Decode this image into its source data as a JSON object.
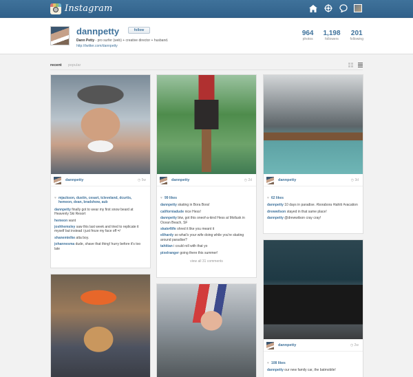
{
  "header": {
    "brand": "Instagram",
    "icons": [
      "home-icon",
      "explore-icon",
      "news-icon",
      "user-avatar"
    ]
  },
  "profile": {
    "username": "dannpetty",
    "follow_label": "follow",
    "bio_name": "Dann Petty",
    "bio_text": " - pro surfer (web) + creative director + husband.",
    "url": "http://twitter.com/dannpetty",
    "stats": [
      {
        "num": "964",
        "label": "photos"
      },
      {
        "num": "1,198",
        "label": "followers"
      },
      {
        "num": "201",
        "label": "following"
      }
    ]
  },
  "tabs": {
    "recent": "recent",
    "popular": "popular"
  },
  "posts": [
    {
      "user": "dannpetty",
      "time": "5w",
      "likes": "mjackson, dustin, cesart, tcleveland, dcurtis, hemeon, dean, bradshow, aub",
      "comments": [
        {
          "u": "dannpetty",
          "t": "finally got to wear my first snow beard at Heavenly Ski Resort"
        },
        {
          "u": "hemeon",
          "t": "want"
        },
        {
          "u": "joshhemsley",
          "t": "saw this last week and tried to replicate it myself but instead i just froze my face off =/"
        },
        {
          "u": "shanemielke",
          "t": "atta boy."
        },
        {
          "u": "johannesma",
          "t": "dude, shave that thing! hurry before it's too late"
        }
      ]
    },
    {
      "user": "dannpetty",
      "time": "2d",
      "likes": "99 likes",
      "comments": [
        {
          "u": "dannpetty",
          "t": "skating in Bora Bora!"
        },
        {
          "u": "californiadude",
          "t": "nice Hess!"
        },
        {
          "u": "dannpetty",
          "t": "btw, got this oneof-a-kind Hess at Mollusk in Ocean Beach, SF"
        },
        {
          "u": "skate4life",
          "t": "shred it like you meant it"
        },
        {
          "u": "elihardy",
          "t": "so what's your wife doing while you're skating around paradise?"
        },
        {
          "u": "tahitian",
          "t": "i could roll with that yo"
        },
        {
          "u": "pixelranger",
          "t": "going there this summer!"
        }
      ],
      "view_all": "view all 31 comments"
    },
    {
      "user": "dannpetty",
      "time": "3d",
      "likes": "62 likes",
      "comments": [
        {
          "u": "dannpetty",
          "t": "10 days in paradise. #borabora #tahiti #vacation"
        },
        {
          "u": "drewwilson",
          "t": "stayed in that same place!"
        },
        {
          "u": "dannpetty",
          "t": "@drewwilson cray cray!"
        }
      ]
    },
    {
      "user": "dannpetty",
      "time": "2w",
      "likes": "108 likes",
      "comments": [
        {
          "u": "dannpetty",
          "t": "our new family car, the batmobile!"
        }
      ]
    }
  ]
}
